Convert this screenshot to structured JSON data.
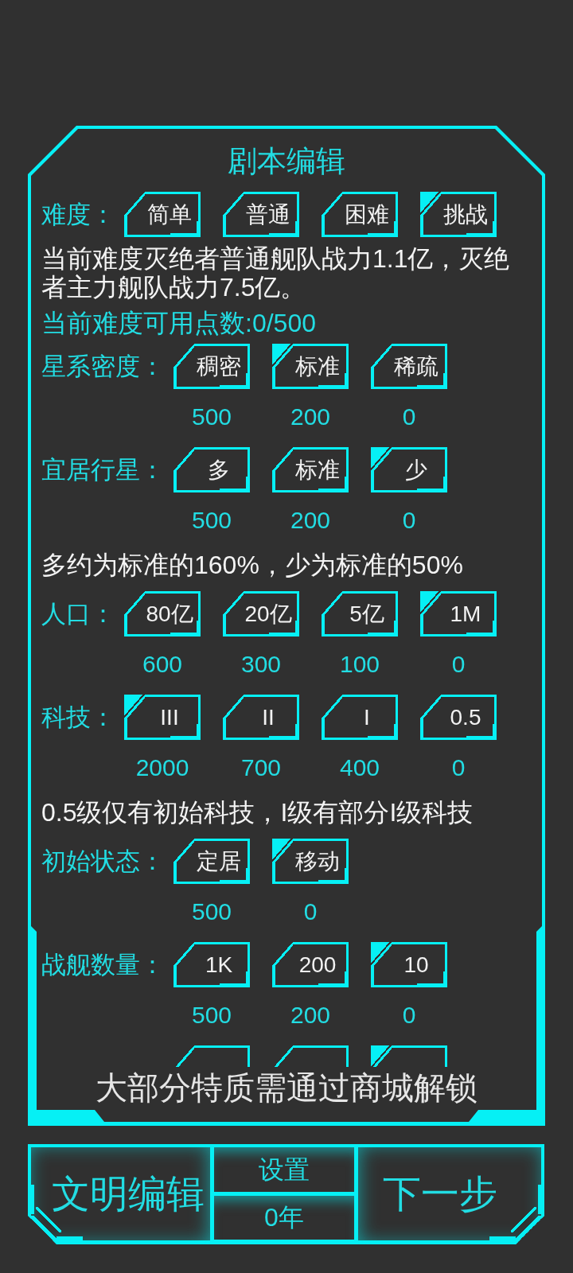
{
  "title": "剧本编辑",
  "sections": [
    {
      "kind": "options",
      "label": "难度：",
      "options": [
        {
          "text": "简单",
          "selected": false
        },
        {
          "text": "普通",
          "selected": false
        },
        {
          "text": "困难",
          "selected": false
        },
        {
          "text": "挑战",
          "selected": true
        }
      ]
    },
    {
      "kind": "text",
      "text": "当前难度灭绝者普通舰队战力1.1亿，灭绝者主力舰队战力7.5亿。"
    },
    {
      "kind": "points",
      "text": "当前难度可用点数:0/500"
    },
    {
      "kind": "options",
      "label": "星系密度：",
      "options": [
        {
          "text": "稠密",
          "selected": false,
          "cost": "500"
        },
        {
          "text": "标准",
          "selected": true,
          "cost": "200"
        },
        {
          "text": "稀疏",
          "selected": false,
          "cost": "0"
        }
      ]
    },
    {
      "kind": "options",
      "label": "宜居行星：",
      "options": [
        {
          "text": "多",
          "selected": false,
          "cost": "500"
        },
        {
          "text": "标准",
          "selected": false,
          "cost": "200"
        },
        {
          "text": "少",
          "selected": true,
          "cost": "0"
        }
      ]
    },
    {
      "kind": "text",
      "text": "多约为标准的160%，少为标准的50%"
    },
    {
      "kind": "options",
      "label": "人口：",
      "options": [
        {
          "text": "80亿",
          "selected": false,
          "cost": "600"
        },
        {
          "text": "20亿",
          "selected": false,
          "cost": "300"
        },
        {
          "text": "5亿",
          "selected": false,
          "cost": "100"
        },
        {
          "text": "1M",
          "selected": true,
          "cost": "0"
        }
      ]
    },
    {
      "kind": "options",
      "label": "科技：",
      "options": [
        {
          "text": "III",
          "selected": true,
          "cost": "2000"
        },
        {
          "text": "II",
          "selected": false,
          "cost": "700"
        },
        {
          "text": "I",
          "selected": false,
          "cost": "400"
        },
        {
          "text": "0.5",
          "selected": false,
          "cost": "0"
        }
      ]
    },
    {
      "kind": "text",
      "text": "0.5级仅有初始科技，I级有部分I级科技"
    },
    {
      "kind": "options",
      "label": "初始状态：",
      "options": [
        {
          "text": "定居",
          "selected": false,
          "cost": "500"
        },
        {
          "text": "移动",
          "selected": true,
          "cost": "0"
        }
      ]
    },
    {
      "kind": "options",
      "label": "战舰数量：",
      "options": [
        {
          "text": "1K",
          "selected": false,
          "cost": "500"
        },
        {
          "text": "200",
          "selected": false,
          "cost": "200"
        },
        {
          "text": "10",
          "selected": true,
          "cost": "0"
        }
      ]
    },
    {
      "kind": "options",
      "options": [
        {
          "selected": false
        },
        {
          "selected": false
        },
        {
          "selected": true
        }
      ]
    }
  ],
  "notice": "大部分特质需通过商城解锁",
  "bottom_bar": {
    "civilization_edit_button": "文明编辑",
    "settings_button": "设置",
    "year_button": "0年",
    "next_step_button": "下一步"
  }
}
